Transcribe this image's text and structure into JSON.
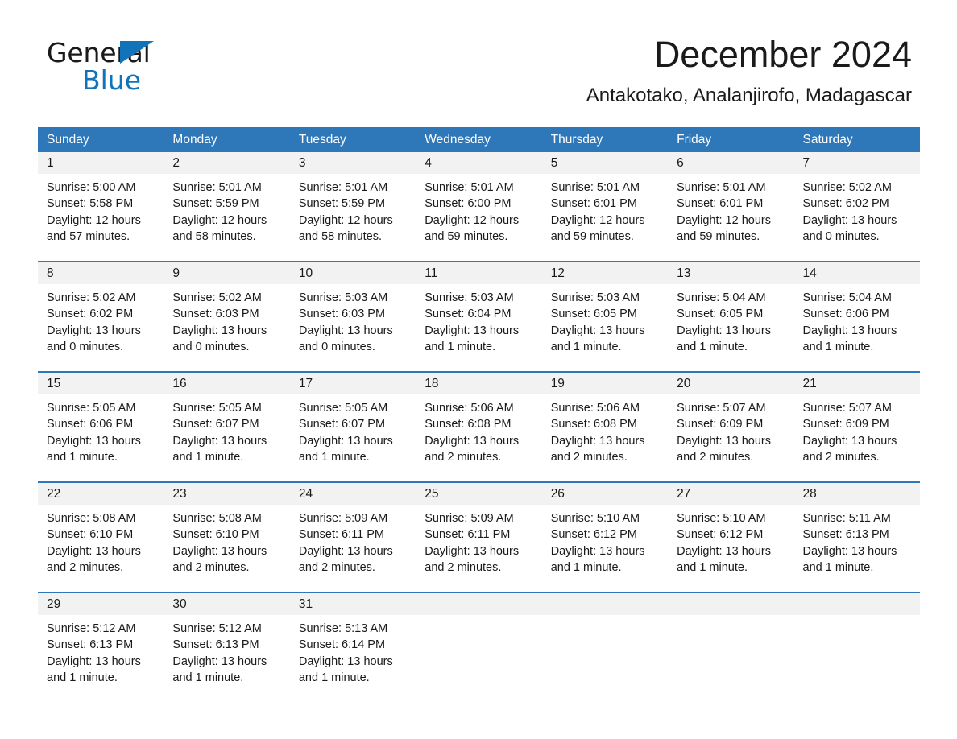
{
  "brand": {
    "name_part1": "General",
    "name_part2": "Blue",
    "accent_color": "#1173ba"
  },
  "header": {
    "title": "December 2024",
    "subtitle": "Antakotako, Analanjirofo, Madagascar"
  },
  "calendar": {
    "header_color": "#2e77b8",
    "weekday_band_color": "#f2f2f2",
    "weekdays": [
      "Sunday",
      "Monday",
      "Tuesday",
      "Wednesday",
      "Thursday",
      "Friday",
      "Saturday"
    ],
    "weeks": [
      [
        {
          "day": "1",
          "sunrise": "Sunrise: 5:00 AM",
          "sunset": "Sunset: 5:58 PM",
          "daylight_line1": "Daylight: 12 hours",
          "daylight_line2": "and 57 minutes."
        },
        {
          "day": "2",
          "sunrise": "Sunrise: 5:01 AM",
          "sunset": "Sunset: 5:59 PM",
          "daylight_line1": "Daylight: 12 hours",
          "daylight_line2": "and 58 minutes."
        },
        {
          "day": "3",
          "sunrise": "Sunrise: 5:01 AM",
          "sunset": "Sunset: 5:59 PM",
          "daylight_line1": "Daylight: 12 hours",
          "daylight_line2": "and 58 minutes."
        },
        {
          "day": "4",
          "sunrise": "Sunrise: 5:01 AM",
          "sunset": "Sunset: 6:00 PM",
          "daylight_line1": "Daylight: 12 hours",
          "daylight_line2": "and 59 minutes."
        },
        {
          "day": "5",
          "sunrise": "Sunrise: 5:01 AM",
          "sunset": "Sunset: 6:01 PM",
          "daylight_line1": "Daylight: 12 hours",
          "daylight_line2": "and 59 minutes."
        },
        {
          "day": "6",
          "sunrise": "Sunrise: 5:01 AM",
          "sunset": "Sunset: 6:01 PM",
          "daylight_line1": "Daylight: 12 hours",
          "daylight_line2": "and 59 minutes."
        },
        {
          "day": "7",
          "sunrise": "Sunrise: 5:02 AM",
          "sunset": "Sunset: 6:02 PM",
          "daylight_line1": "Daylight: 13 hours",
          "daylight_line2": "and 0 minutes."
        }
      ],
      [
        {
          "day": "8",
          "sunrise": "Sunrise: 5:02 AM",
          "sunset": "Sunset: 6:02 PM",
          "daylight_line1": "Daylight: 13 hours",
          "daylight_line2": "and 0 minutes."
        },
        {
          "day": "9",
          "sunrise": "Sunrise: 5:02 AM",
          "sunset": "Sunset: 6:03 PM",
          "daylight_line1": "Daylight: 13 hours",
          "daylight_line2": "and 0 minutes."
        },
        {
          "day": "10",
          "sunrise": "Sunrise: 5:03 AM",
          "sunset": "Sunset: 6:03 PM",
          "daylight_line1": "Daylight: 13 hours",
          "daylight_line2": "and 0 minutes."
        },
        {
          "day": "11",
          "sunrise": "Sunrise: 5:03 AM",
          "sunset": "Sunset: 6:04 PM",
          "daylight_line1": "Daylight: 13 hours",
          "daylight_line2": "and 1 minute."
        },
        {
          "day": "12",
          "sunrise": "Sunrise: 5:03 AM",
          "sunset": "Sunset: 6:05 PM",
          "daylight_line1": "Daylight: 13 hours",
          "daylight_line2": "and 1 minute."
        },
        {
          "day": "13",
          "sunrise": "Sunrise: 5:04 AM",
          "sunset": "Sunset: 6:05 PM",
          "daylight_line1": "Daylight: 13 hours",
          "daylight_line2": "and 1 minute."
        },
        {
          "day": "14",
          "sunrise": "Sunrise: 5:04 AM",
          "sunset": "Sunset: 6:06 PM",
          "daylight_line1": "Daylight: 13 hours",
          "daylight_line2": "and 1 minute."
        }
      ],
      [
        {
          "day": "15",
          "sunrise": "Sunrise: 5:05 AM",
          "sunset": "Sunset: 6:06 PM",
          "daylight_line1": "Daylight: 13 hours",
          "daylight_line2": "and 1 minute."
        },
        {
          "day": "16",
          "sunrise": "Sunrise: 5:05 AM",
          "sunset": "Sunset: 6:07 PM",
          "daylight_line1": "Daylight: 13 hours",
          "daylight_line2": "and 1 minute."
        },
        {
          "day": "17",
          "sunrise": "Sunrise: 5:05 AM",
          "sunset": "Sunset: 6:07 PM",
          "daylight_line1": "Daylight: 13 hours",
          "daylight_line2": "and 1 minute."
        },
        {
          "day": "18",
          "sunrise": "Sunrise: 5:06 AM",
          "sunset": "Sunset: 6:08 PM",
          "daylight_line1": "Daylight: 13 hours",
          "daylight_line2": "and 2 minutes."
        },
        {
          "day": "19",
          "sunrise": "Sunrise: 5:06 AM",
          "sunset": "Sunset: 6:08 PM",
          "daylight_line1": "Daylight: 13 hours",
          "daylight_line2": "and 2 minutes."
        },
        {
          "day": "20",
          "sunrise": "Sunrise: 5:07 AM",
          "sunset": "Sunset: 6:09 PM",
          "daylight_line1": "Daylight: 13 hours",
          "daylight_line2": "and 2 minutes."
        },
        {
          "day": "21",
          "sunrise": "Sunrise: 5:07 AM",
          "sunset": "Sunset: 6:09 PM",
          "daylight_line1": "Daylight: 13 hours",
          "daylight_line2": "and 2 minutes."
        }
      ],
      [
        {
          "day": "22",
          "sunrise": "Sunrise: 5:08 AM",
          "sunset": "Sunset: 6:10 PM",
          "daylight_line1": "Daylight: 13 hours",
          "daylight_line2": "and 2 minutes."
        },
        {
          "day": "23",
          "sunrise": "Sunrise: 5:08 AM",
          "sunset": "Sunset: 6:10 PM",
          "daylight_line1": "Daylight: 13 hours",
          "daylight_line2": "and 2 minutes."
        },
        {
          "day": "24",
          "sunrise": "Sunrise: 5:09 AM",
          "sunset": "Sunset: 6:11 PM",
          "daylight_line1": "Daylight: 13 hours",
          "daylight_line2": "and 2 minutes."
        },
        {
          "day": "25",
          "sunrise": "Sunrise: 5:09 AM",
          "sunset": "Sunset: 6:11 PM",
          "daylight_line1": "Daylight: 13 hours",
          "daylight_line2": "and 2 minutes."
        },
        {
          "day": "26",
          "sunrise": "Sunrise: 5:10 AM",
          "sunset": "Sunset: 6:12 PM",
          "daylight_line1": "Daylight: 13 hours",
          "daylight_line2": "and 1 minute."
        },
        {
          "day": "27",
          "sunrise": "Sunrise: 5:10 AM",
          "sunset": "Sunset: 6:12 PM",
          "daylight_line1": "Daylight: 13 hours",
          "daylight_line2": "and 1 minute."
        },
        {
          "day": "28",
          "sunrise": "Sunrise: 5:11 AM",
          "sunset": "Sunset: 6:13 PM",
          "daylight_line1": "Daylight: 13 hours",
          "daylight_line2": "and 1 minute."
        }
      ],
      [
        {
          "day": "29",
          "sunrise": "Sunrise: 5:12 AM",
          "sunset": "Sunset: 6:13 PM",
          "daylight_line1": "Daylight: 13 hours",
          "daylight_line2": "and 1 minute."
        },
        {
          "day": "30",
          "sunrise": "Sunrise: 5:12 AM",
          "sunset": "Sunset: 6:13 PM",
          "daylight_line1": "Daylight: 13 hours",
          "daylight_line2": "and 1 minute."
        },
        {
          "day": "31",
          "sunrise": "Sunrise: 5:13 AM",
          "sunset": "Sunset: 6:14 PM",
          "daylight_line1": "Daylight: 13 hours",
          "daylight_line2": "and 1 minute."
        },
        {
          "day": "",
          "sunrise": "",
          "sunset": "",
          "daylight_line1": "",
          "daylight_line2": ""
        },
        {
          "day": "",
          "sunrise": "",
          "sunset": "",
          "daylight_line1": "",
          "daylight_line2": ""
        },
        {
          "day": "",
          "sunrise": "",
          "sunset": "",
          "daylight_line1": "",
          "daylight_line2": ""
        },
        {
          "day": "",
          "sunrise": "",
          "sunset": "",
          "daylight_line1": "",
          "daylight_line2": ""
        }
      ]
    ]
  }
}
